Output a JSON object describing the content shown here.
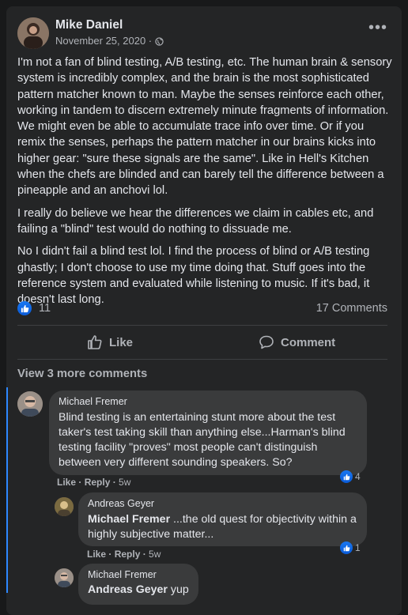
{
  "post": {
    "author": "Mike Daniel",
    "date": "November 25, 2020 ·",
    "privacy_icon": "globe-icon",
    "menu_icon": "more-icon",
    "paragraphs": [
      "I'm not a fan of blind testing, A/B testing, etc. The human brain & sensory system is incredibly complex, and the brain is the most sophisticated pattern matcher known to man. Maybe the senses reinforce each other, working in tandem to discern extremely minute fragments of information. We might even be able to accumulate trace info over time. Or if you remix the senses, perhaps the pattern matcher in our brains kicks into higher gear: \"sure these signals are the same\". Like in Hell's Kitchen when the chefs are blinded and can barely tell the difference between a pineapple and an anchovi lol.",
      "I really do believe we hear the differences we claim in cables etc, and failing a \"blind\" test would do nothing to dissuade me.",
      "No I didn't fail a blind test lol. I find the process of blind or A/B testing ghastly; I don't choose to use my time doing that. Stuff goes into the reference system and evaluated while listening to music. If it's bad, it doesn't last long."
    ],
    "reaction_count": "11",
    "comments_count": "17 Comments",
    "like_label": "Like",
    "comment_label": "Comment",
    "view_more": "View 3 more comments",
    "accent_color": "#2d88ff"
  },
  "comments": [
    {
      "author": "Michael Fremer",
      "mention": "",
      "text": "Blind testing is an entertaining stunt more about the test taker's test taking skill than anything else...Harman's blind testing facility \"proves\" most people can't distinguish between very different sounding speakers. So?",
      "like": "Like",
      "reply": "Reply",
      "time": "5w",
      "reactions": "4"
    },
    {
      "author": "Andreas Geyer",
      "mention": "Michael Fremer",
      "text": " ...the old quest for objectivity within a highly subjective matter...",
      "like": "Like",
      "reply": "Reply",
      "time": "5w",
      "reactions": "1"
    },
    {
      "author": "Michael Fremer",
      "mention": "Andreas Geyer",
      "text": " yup",
      "like": "",
      "reply": "",
      "time": "",
      "reactions": ""
    }
  ]
}
